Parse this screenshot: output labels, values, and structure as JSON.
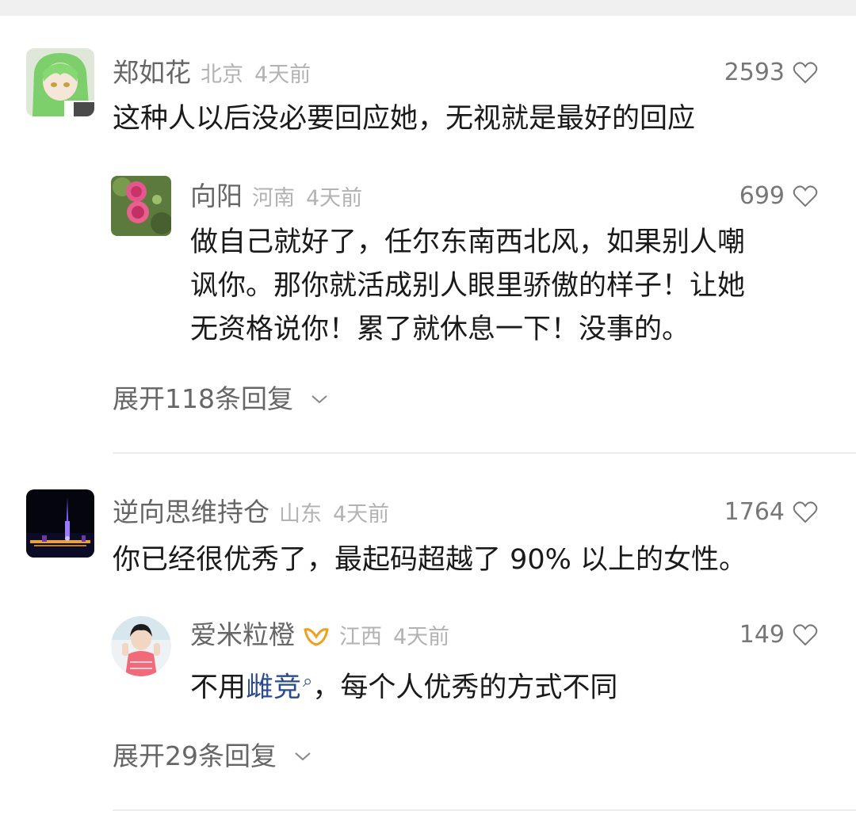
{
  "comments": [
    {
      "user": "郑如花",
      "location": "北京",
      "time": "4天前",
      "likes": "2593",
      "text": "这种人以后没必要回应她，无视就是最好的回应",
      "reply": {
        "user": "向阳",
        "location": "河南",
        "time": "4天前",
        "likes": "699",
        "lines": [
          "做自己就好了，任尔东南西北风，如果别人嘲",
          "讽你。那你就活成别人眼里骄傲的样子！让她",
          "无资格说你！累了就休息一下！没事的。"
        ]
      },
      "expand_label": "展开118条回复"
    },
    {
      "user": "逆向思维持仓",
      "location": "山东",
      "time": "4天前",
      "likes": "1764",
      "text": "你已经很优秀了，最起码超越了 90% 以上的女性。",
      "reply": {
        "user": "爱米粒橙",
        "location": "江西",
        "time": "4天前",
        "likes": "149",
        "text_before": "不用",
        "link_text": "雌竞",
        "text_after": "，每个人优秀的方式不同"
      },
      "expand_label": "展开29条回复"
    }
  ],
  "icons": {
    "like": "heart-outline-icon",
    "expand": "chevron-down-icon",
    "badge": "vip-badge-icon",
    "link_search": "search-icon"
  },
  "colors": {
    "text": "#1a1a1a",
    "name": "#666666",
    "meta": "#b2b2b2",
    "link": "#2b4b8c",
    "badge": "#f0a020"
  }
}
